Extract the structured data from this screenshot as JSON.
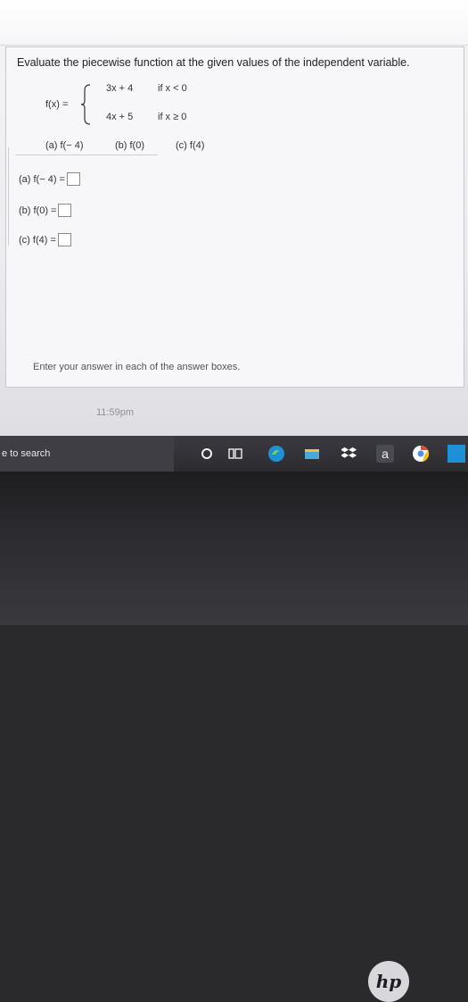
{
  "question": {
    "instruction": "Evaluate the piecewise function at the given values of the independent variable.",
    "function_label": "f(x) =",
    "pieces": [
      {
        "expr": "3x + 4",
        "cond": "if x < 0"
      },
      {
        "expr": "4x + 5",
        "cond": "if x ≥ 0"
      }
    ],
    "parts": [
      "(a) f(− 4)",
      "(b) f(0)",
      "(c) f(4)"
    ],
    "answers": [
      {
        "label": "(a) f(− 4) =",
        "value": ""
      },
      {
        "label": "(b) f(0) =",
        "value": ""
      },
      {
        "label": "(c) f(4) =",
        "value": ""
      }
    ],
    "hint": "Enter your answer in each of the answer boxes."
  },
  "clock": "11:59pm",
  "taskbar": {
    "search_text": "e to search",
    "icons": [
      "cortana-circle-icon",
      "task-view-icon",
      "edge-icon",
      "file-explorer-icon",
      "dropbox-icon",
      "amazon-icon",
      "chrome-icon",
      "notification-badge-icon"
    ],
    "letter_a": "a"
  },
  "colors": {
    "panel": "#f7f7f9",
    "taskbar": "#2b2b30",
    "accent_edge": "#1e90d6"
  }
}
